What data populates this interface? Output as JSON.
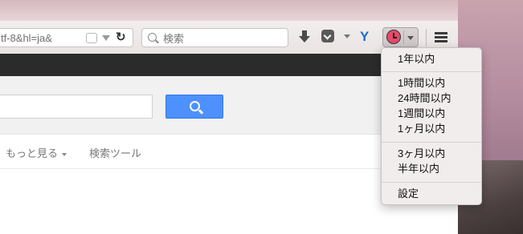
{
  "toolbar": {
    "url_fragment": "tf-8&hl=ja&",
    "search_placeholder": "検索"
  },
  "page": {
    "tabs": {
      "more_label": "もっと見る",
      "tools_label": "検索ツール"
    }
  },
  "menu": {
    "items": [
      "1年以内",
      "1時間以内",
      "24時間以内",
      "1週間以内",
      "1ヶ月以内",
      "3ヶ月以内",
      "半年以内",
      "設定"
    ]
  },
  "colors": {
    "search_button": "#4d90fe",
    "clock_accent": "#e64a6a",
    "dark_strip": "#2b2b2b"
  }
}
